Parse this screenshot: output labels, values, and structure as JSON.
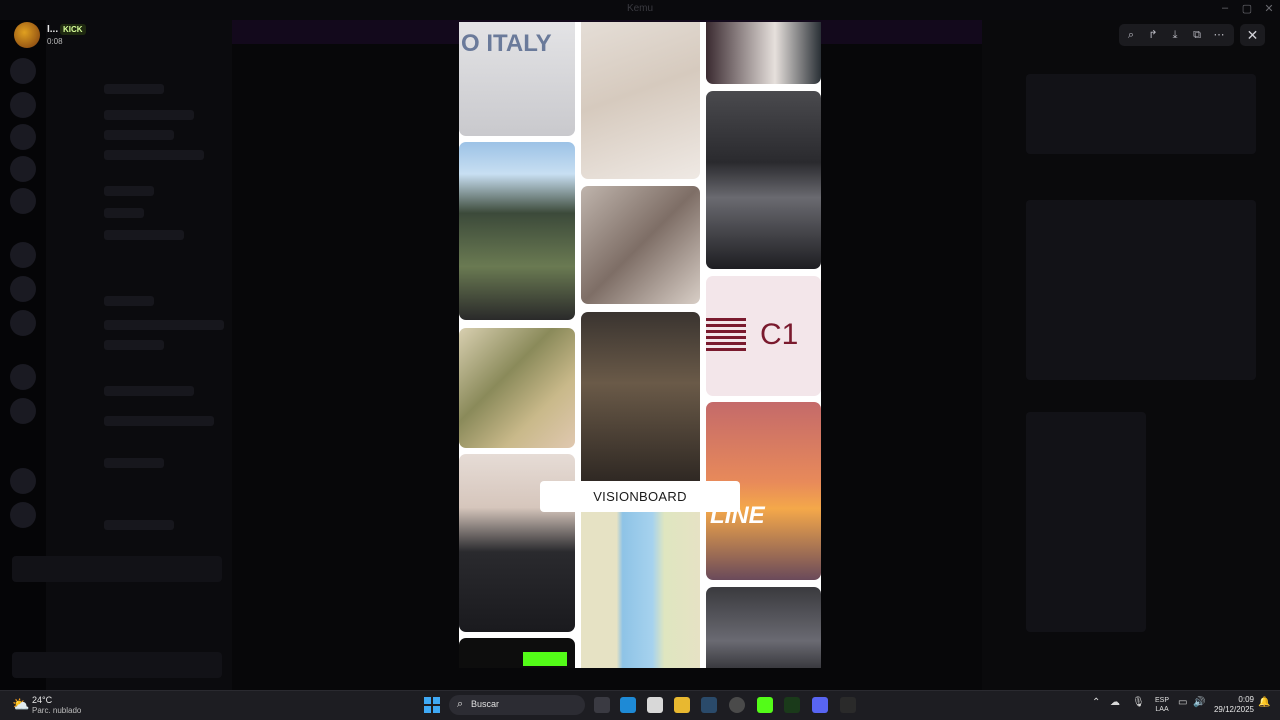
{
  "window": {
    "title": "Kemu"
  },
  "stream": {
    "user_name": "I...",
    "badge": "KICK",
    "elapsed": "0:08"
  },
  "viewer_tools": {
    "zoom_icon": "zoom-in-icon",
    "share_icon": "share-icon",
    "download_icon": "download-icon",
    "open_icon": "open-external-icon",
    "more_icon": "more-icon",
    "close_icon": "close-icon"
  },
  "visionboard": {
    "label": "VISIONBOARD",
    "italy_text": "O ITALY",
    "c1_text": "C1",
    "online_text": "LINE"
  },
  "taskbar": {
    "temperature": "24°C",
    "condition": "Parc. nublado",
    "search_placeholder": "Buscar",
    "lang_top": "ESP",
    "lang_bottom": "LAA",
    "time": "0:09",
    "date": "29/12/2025"
  },
  "colors": {
    "accent": "#3fa9f5",
    "kick_green": "#53fc18"
  }
}
